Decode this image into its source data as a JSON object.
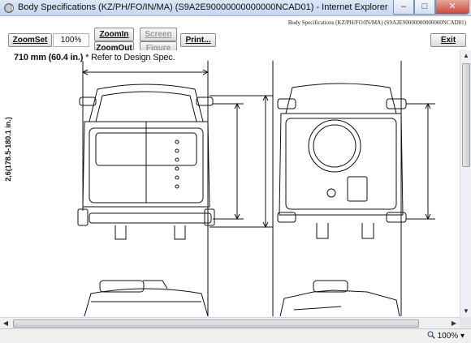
{
  "window": {
    "title": "Body Specifications (KZ/PH/FO/IN/MA) (S9A2E90000000000000NCAD01) - Internet Explorer",
    "minimize": "–",
    "maximize": "□",
    "close": "✕"
  },
  "document": {
    "caption": "Body Specifications (KZ/PH/FO/IN/MA) (S9A2E90000000000000NCAD01)"
  },
  "toolbar": {
    "zoom_set": "ZoomSet",
    "zoom_value": "100%",
    "zoom_in": "ZoomIn",
    "zoom_out": "ZoomOut",
    "screen": "Screen",
    "figure": "Figure",
    "print": "Print...",
    "exit": "Exit"
  },
  "drawing": {
    "vertical_dimension": "2,6(178.5-180.1 in.)",
    "overlap_text_bold": "710 mm (60.4 in.)",
    "overlap_text": "* Refer to Design Spec."
  },
  "statusbar": {
    "zoom": "100%",
    "zoom_icon": "magnifier-icon",
    "dropdown_icon": "chevron-down-icon"
  },
  "colors": {
    "titlebar": "#c5d7ef",
    "close_button": "#c8463a",
    "line": "#111111"
  }
}
